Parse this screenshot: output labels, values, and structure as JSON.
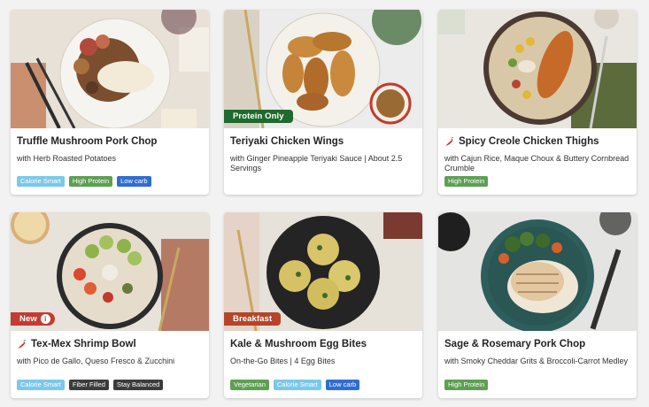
{
  "colors": {
    "page_background": "#f2f2f2",
    "calorie_smart": "#7ac9e9",
    "high_protein": "#5e9f53",
    "low_carb": "#2f6ed1",
    "dark_badge": "#3c3c3c",
    "vegetarian": "#5e9f53",
    "protein_only_tag": "#1f6a2e",
    "new_tag": "#c33b32",
    "breakfast_tag": "#b5452a"
  },
  "cards": [
    {
      "title": "Truffle Mushroom Pork Chop",
      "description": "with Herb Roasted Potatoes",
      "badges": [
        "Calorie Smart",
        "High Protein",
        "Low carb"
      ]
    },
    {
      "tag": "Protein Only",
      "title": "Teriyaki Chicken Wings",
      "description": "with Ginger Pineapple Teriyaki Sauce | About 2.5 Servings",
      "badges": []
    },
    {
      "spicy_icon": "chili-pepper-icon",
      "title": "Spicy Creole Chicken Thighs",
      "description": "with Cajun Rice, Maque Choux & Buttery Cornbread Crumble",
      "badges": [
        "High Protein"
      ]
    },
    {
      "tag": "New",
      "tag_icon": "info-icon",
      "spicy_icon": "chili-pepper-icon",
      "title": "Tex-Mex Shrimp Bowl",
      "description": "with Pico de Gallo, Queso Fresco & Zucchini",
      "badges": [
        "Calorie Smart",
        "Fiber Filled",
        "Stay Balanced"
      ]
    },
    {
      "tag": "Breakfast",
      "title": "Kale & Mushroom Egg Bites",
      "description": "On-the-Go Bites | 4 Egg Bites",
      "badges": [
        "Vegetarian",
        "Calorie Smart",
        "Low carb"
      ]
    },
    {
      "title": "Sage & Rosemary Pork Chop",
      "description": "with Smoky Cheddar Grits & Broccoli-Carrot Medley",
      "badges": [
        "High Protein"
      ]
    }
  ]
}
